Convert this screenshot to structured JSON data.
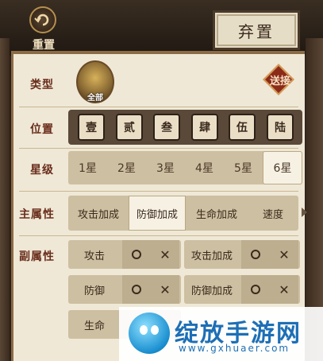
{
  "header": {
    "reset_label": "重置",
    "discard_label": "弃置"
  },
  "type_row": {
    "label": "类型",
    "selected": "全部",
    "filter_badge": "送接"
  },
  "position_row": {
    "label": "位置",
    "items": [
      "壹",
      "贰",
      "叁",
      "肆",
      "伍",
      "陆"
    ]
  },
  "star_row": {
    "label": "星级",
    "items": [
      "1星",
      "2星",
      "3星",
      "4星",
      "5星",
      "6星"
    ],
    "selected": "6星"
  },
  "main_attr_row": {
    "label": "主属性",
    "items": [
      "攻击加成",
      "防御加成",
      "生命加成",
      "速度"
    ],
    "selected": "防御加成"
  },
  "sub_attr_row": {
    "label": "副属性",
    "cells": [
      {
        "label": "攻击",
        "include": "○",
        "exclude": "✕"
      },
      {
        "label": "攻击加成",
        "include": "○",
        "exclude": "✕"
      },
      {
        "label": "防御",
        "include": "○",
        "exclude": "✕"
      },
      {
        "label": "防御加成",
        "include": "○",
        "exclude": "✕"
      },
      {
        "label": "生命"
      }
    ]
  },
  "watermark": {
    "text": "绽放手游网",
    "url": "www.gxhuaer.com"
  }
}
